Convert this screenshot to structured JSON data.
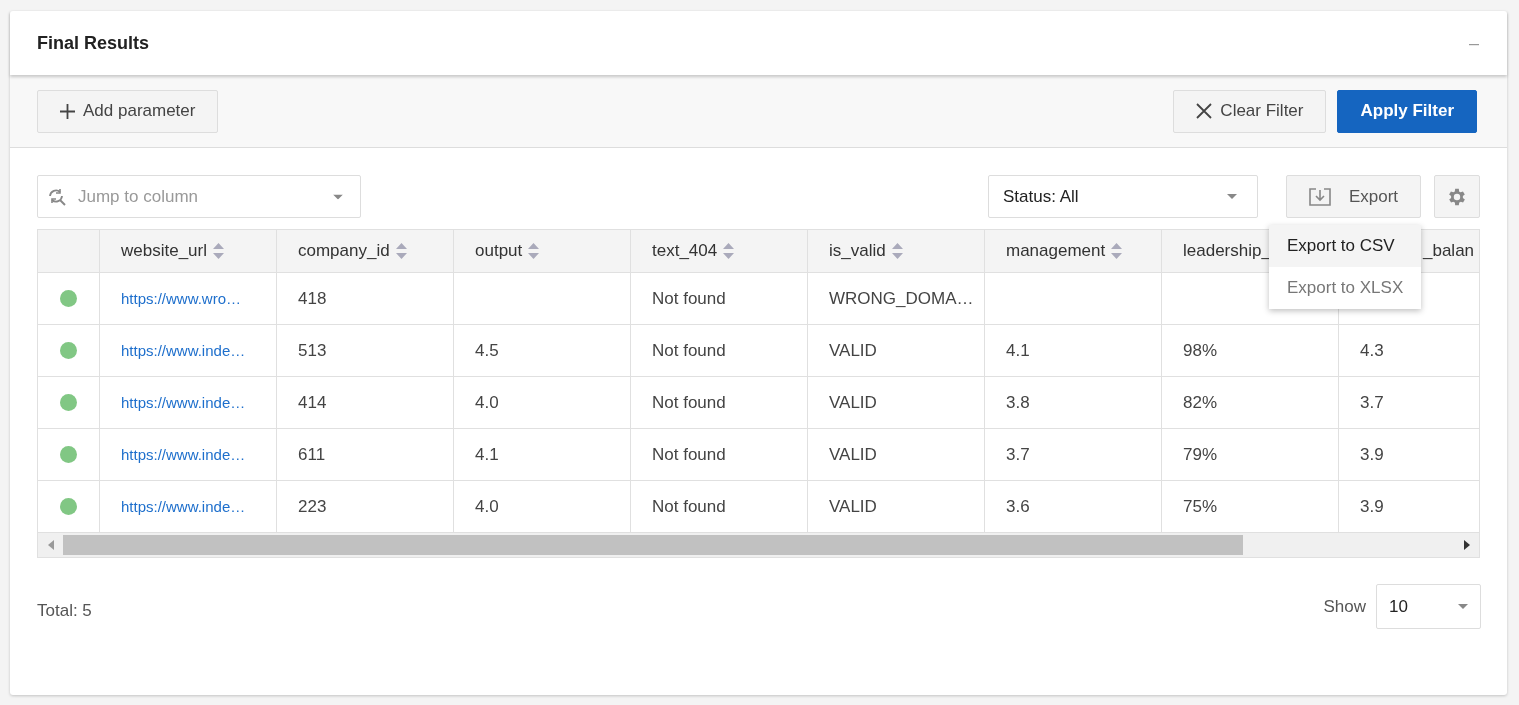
{
  "panel": {
    "title": "Final Results",
    "collapse_icon": "–"
  },
  "toolbar": {
    "add_button": "Add parameter",
    "clear_button": "Clear Filter",
    "apply_button": "Apply Filter"
  },
  "jump_field": {
    "placeholder": "Jump to column"
  },
  "status_filter": {
    "value": "Status: All"
  },
  "export_button": "Export",
  "export_menu": [
    {
      "label": "Export to CSV",
      "selected": true
    },
    {
      "label": "Export to XLSX",
      "selected": false
    }
  ],
  "table": {
    "columns": [
      {
        "label": "website_url",
        "sortable": true
      },
      {
        "label": "company_id",
        "sortable": true
      },
      {
        "label": "output",
        "sortable": true
      },
      {
        "label": "text_404",
        "sortable": true
      },
      {
        "label": "is_valid",
        "sortable": true
      },
      {
        "label": "management",
        "sortable": true
      },
      {
        "label": "leadership_"
      },
      {
        "label": "_balan"
      }
    ],
    "rows": [
      {
        "color": "#81c784",
        "cells": [
          "https://www.wro…",
          "418",
          null,
          "Not found",
          "WRONG_DOMA…",
          null,
          null,
          null
        ]
      },
      {
        "color": "#81c784",
        "cells": [
          "https://www.inde…",
          "513",
          "4.5",
          "Not found",
          "VALID",
          "4.1",
          "98%",
          "4.3"
        ]
      },
      {
        "color": "#81c784",
        "cells": [
          "https://www.inde…",
          "414",
          "4.0",
          "Not found",
          "VALID",
          "3.8",
          "82%",
          "3.7"
        ]
      },
      {
        "color": "#81c784",
        "cells": [
          "https://www.inde…",
          "611",
          "4.1",
          "Not found",
          "VALID",
          "3.7",
          "79%",
          "3.9"
        ]
      },
      {
        "color": "#81c784",
        "cells": [
          "https://www.inde…",
          "223",
          "4.0",
          "Not found",
          "VALID",
          "3.6",
          "75%",
          "3.9"
        ]
      }
    ]
  },
  "footer": {
    "total": "Total: 5",
    "show_label": "Show",
    "page_size": "10"
  }
}
